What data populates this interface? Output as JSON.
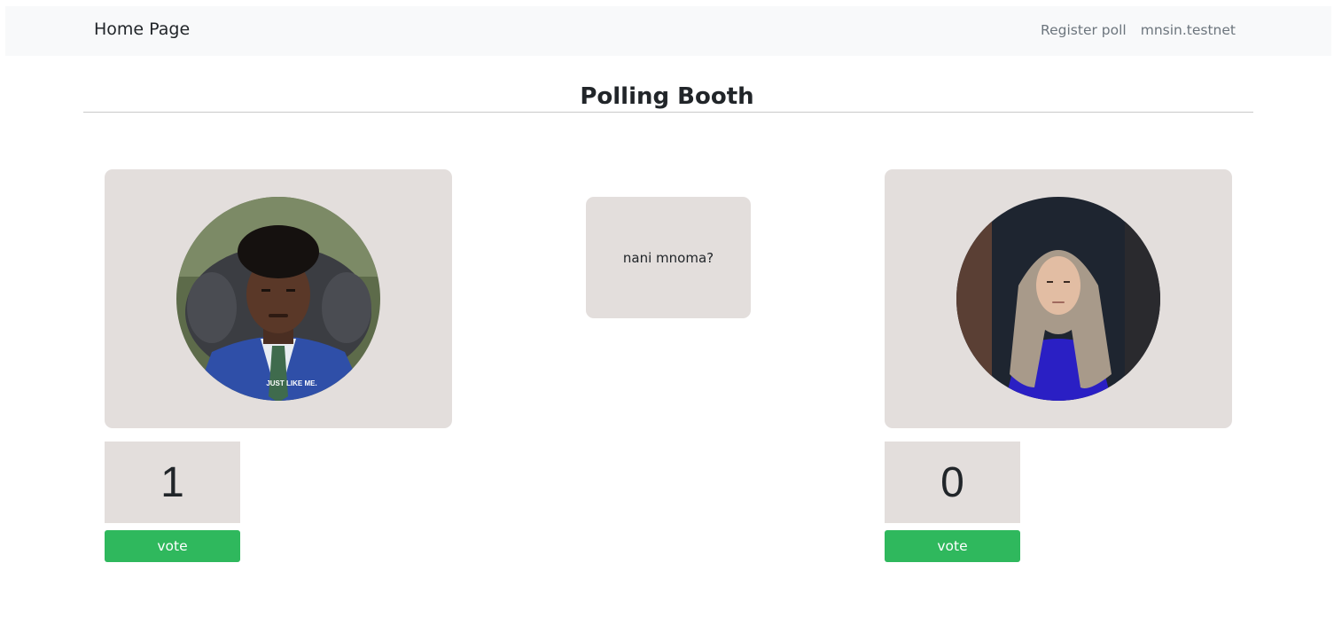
{
  "navbar": {
    "brand": "Home Page",
    "links": [
      "Register poll",
      "mnsin.testnet"
    ]
  },
  "page_title": "Polling Booth",
  "question": "nani mnoma?",
  "candidates": [
    {
      "photo_icon": "candidate-photo-man-in-blue-suit",
      "photo_caption": "JUST LIKE ME.",
      "votes": "1",
      "vote_label": "vote"
    },
    {
      "photo_icon": "candidate-photo-woman-in-headscarf",
      "votes": "0",
      "vote_label": "vote"
    }
  ],
  "colors": {
    "navbar_bg": "#f8f9fa",
    "card_bg": "#e3dedc",
    "vote_button": "#2fb85d",
    "nav_link": "#6c757d"
  }
}
